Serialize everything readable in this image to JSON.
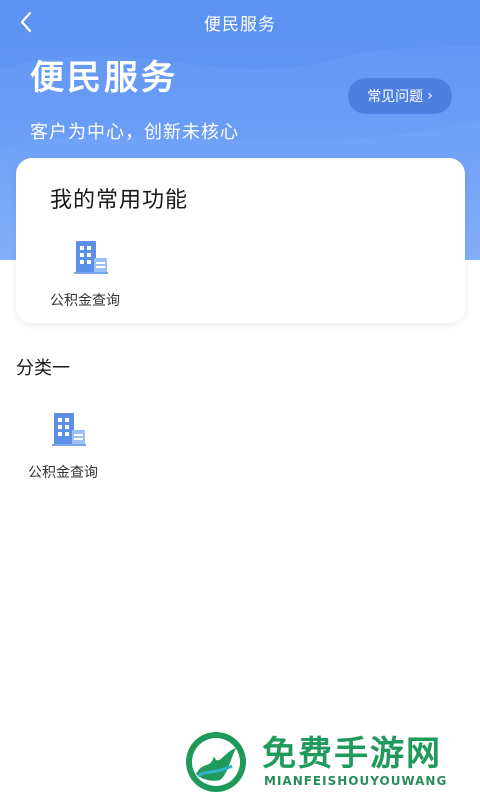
{
  "header": {
    "title": "便民服务",
    "back_icon": "chevron-left-icon"
  },
  "hero": {
    "title": "便民服务",
    "subtitle": "客户为中心，创新未核心",
    "faq_label": "常见问题",
    "faq_chevron": "›"
  },
  "favorites": {
    "title": "我的常用功能",
    "items": [
      {
        "label": "公积金查询",
        "icon": "building-icon"
      }
    ]
  },
  "category": {
    "title": "分类一",
    "items": [
      {
        "label": "公积金查询",
        "icon": "building-icon"
      }
    ]
  },
  "watermark": {
    "name": "免费手游网",
    "sub": "MIANFEISHOUYOUWANG"
  },
  "colors": {
    "hero_start": "#5f95f3",
    "hero_end": "#86b2fb",
    "faq_bg": "#4d7fe0",
    "icon_blue": "#5b8fe8",
    "watermark_green": "#1f9a5a"
  }
}
